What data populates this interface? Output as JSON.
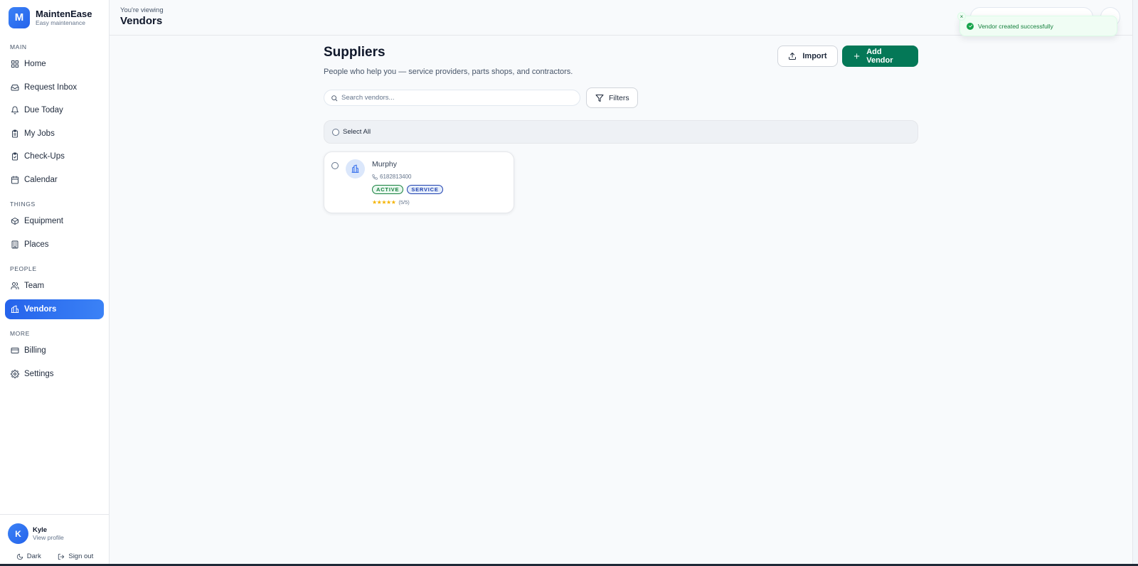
{
  "brand": {
    "initial": "M",
    "name": "MaintenEase",
    "tagline": "Easy maintenance"
  },
  "sidebar": {
    "sections": [
      {
        "label": "MAIN",
        "items": [
          {
            "label": "Home",
            "icon": "grid-icon"
          },
          {
            "label": "Request Inbox",
            "icon": "inbox-icon"
          },
          {
            "label": "Due Today",
            "icon": "bell-icon"
          },
          {
            "label": "My Jobs",
            "icon": "clipboard-icon"
          },
          {
            "label": "Check-Ups",
            "icon": "clipboard-check-icon"
          },
          {
            "label": "Calendar",
            "icon": "calendar-icon"
          }
        ]
      },
      {
        "label": "THINGS",
        "items": [
          {
            "label": "Equipment",
            "icon": "box-icon"
          },
          {
            "label": "Places",
            "icon": "building-icon"
          }
        ]
      },
      {
        "label": "PEOPLE",
        "items": [
          {
            "label": "Team",
            "icon": "users-icon"
          },
          {
            "label": "Vendors",
            "icon": "vendors-icon",
            "active": true
          }
        ]
      },
      {
        "label": "MORE",
        "items": [
          {
            "label": "Billing",
            "icon": "credit-card-icon"
          },
          {
            "label": "Settings",
            "icon": "gear-icon"
          }
        ]
      }
    ]
  },
  "user": {
    "initial": "K",
    "name": "Kyle",
    "sub": "View profile",
    "dark_label": "Dark",
    "signout_label": "Sign out"
  },
  "topbar": {
    "viewing": "You're viewing",
    "title": "Vendors"
  },
  "main": {
    "title": "Suppliers",
    "subtitle": "People who help you — service providers, parts shops, and contractors.",
    "import_label": "Import",
    "add_label": "Add Vendor",
    "search_placeholder": "Search vendors...",
    "filters_label": "Filters",
    "select_all_label": "Select All"
  },
  "vendors": [
    {
      "name": "Murphy",
      "phone": "6182813400",
      "status": "ACTIVE",
      "category": "SERVICE",
      "rating_stars": "★★★★★",
      "rating_text": "(5/5)"
    }
  ],
  "toast": {
    "message": "Vendor created successfully",
    "close": "×"
  },
  "colors": {
    "primary_blue": "#2563eb",
    "primary_green": "#047857",
    "success": "#16a34a",
    "star": "#f5b301"
  }
}
